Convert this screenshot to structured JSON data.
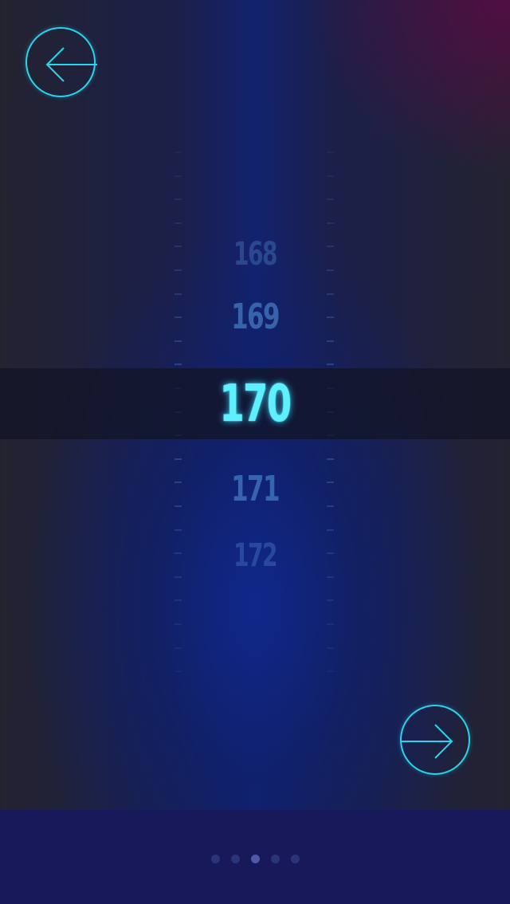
{
  "icons": {
    "back": "arrow-left-circle-icon",
    "next": "arrow-right-circle-icon"
  },
  "colors": {
    "accent": "#27d6ee",
    "selected_value": "#5ff0ff",
    "faded_value": "#4682c8",
    "bottom_bar": "#17195a",
    "dot_inactive": "#2a3478",
    "dot_active": "#4e5aa8"
  },
  "picker": {
    "selected": "170",
    "values": [
      "168",
      "169",
      "170",
      "171",
      "172"
    ]
  },
  "pagination": {
    "count": 5,
    "active_index": 2
  }
}
